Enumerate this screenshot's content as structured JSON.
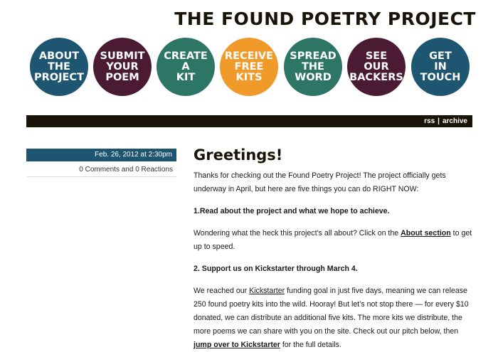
{
  "header": {
    "title": "THE FOUND POETRY PROJECT"
  },
  "nav": [
    {
      "label": "ABOUT THE PROJECT",
      "lines": [
        "ABOUT",
        "THE",
        "PROJECT"
      ],
      "color": "#1e5570"
    },
    {
      "label": "SUBMIT YOUR POEM",
      "lines": [
        "SUBMIT",
        "YOUR",
        "POEM"
      ],
      "color": "#4a1b33"
    },
    {
      "label": "CREATE A KIT",
      "lines": [
        "CREATE",
        "A",
        "KIT"
      ],
      "color": "#2d7565"
    },
    {
      "label": "RECEIVE FREE KITS",
      "lines": [
        "RECEIVE",
        "FREE",
        "KITS"
      ],
      "color": "#f09a2a"
    },
    {
      "label": "SPREAD THE WORD",
      "lines": [
        "SPREAD",
        "THE",
        "WORD"
      ],
      "color": "#2d7565"
    },
    {
      "label": "SEE OUR BACKERS",
      "lines": [
        "SEE",
        "OUR",
        "BACKERS"
      ],
      "color": "#4a1b33"
    },
    {
      "label": "GET IN TOUCH",
      "lines": [
        "GET",
        "IN",
        "TOUCH"
      ],
      "color": "#1e5570"
    }
  ],
  "bar": {
    "rss": "rss",
    "separator": "|",
    "archive": "archive"
  },
  "post": {
    "date": "Feb. 26, 2012 at 2:30pm",
    "comments": "0 Comments and 0 Reactions",
    "title": "Greetings!",
    "p1": "Thanks for checking out the Found Poetry Project! The project officially gets underway in April, but here are five things you can do RIGHT NOW:",
    "h1": "1.Read about the project and what we hope to achieve.",
    "p2_before": "Wondering what the heck this project’s all about? Click on the ",
    "p2_link": "About section",
    "p2_after": " to get up to speed.",
    "h2": "2. Support us on Kickstarter through March 4.",
    "p3_a": "We reached our ",
    "p3_link1": "Kickstarter",
    "p3_b": " funding goal in just five days, meaning we can release 250 found poetry kits into the wild. Hooray! But let’s not stop there — for every $10 donated, we can distribute an additional five kits. The more kits we distribute, the more poems we can share with you on the site. Check out our pitch below, then ",
    "p3_link2": "jump over to Kickstarter",
    "p3_c": " for the full details."
  }
}
